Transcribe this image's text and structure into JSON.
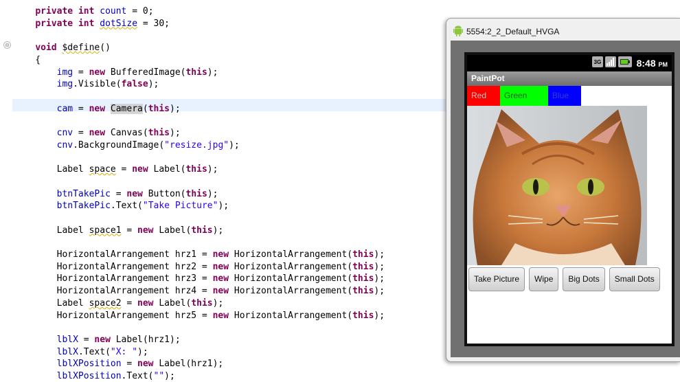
{
  "editor": {
    "fold_marker": "⊖",
    "lines": [
      [
        {
          "t": "    "
        },
        {
          "t": "private",
          "c": "kw"
        },
        {
          "t": " "
        },
        {
          "t": "int",
          "c": "kw"
        },
        {
          "t": " "
        },
        {
          "t": "count",
          "c": "fld"
        },
        {
          "t": " = 0;"
        }
      ],
      [
        {
          "t": "    "
        },
        {
          "t": "private",
          "c": "kw"
        },
        {
          "t": " "
        },
        {
          "t": "int",
          "c": "kw"
        },
        {
          "t": " "
        },
        {
          "t": "dotSize",
          "c": "fld sq"
        },
        {
          "t": " = 30;"
        }
      ],
      [],
      [
        {
          "t": "    "
        },
        {
          "t": "void",
          "c": "kw"
        },
        {
          "t": " "
        },
        {
          "t": "$define",
          "c": "sq"
        },
        {
          "t": "()"
        }
      ],
      [
        {
          "t": "    {"
        }
      ],
      [
        {
          "t": "        "
        },
        {
          "t": "img",
          "c": "fld"
        },
        {
          "t": " = "
        },
        {
          "t": "new",
          "c": "kw"
        },
        {
          "t": " BufferedImage("
        },
        {
          "t": "this",
          "c": "kw"
        },
        {
          "t": ");"
        }
      ],
      [
        {
          "t": "        "
        },
        {
          "t": "img",
          "c": "fld"
        },
        {
          "t": ".Visible("
        },
        {
          "t": "false",
          "c": "kw"
        },
        {
          "t": ");"
        }
      ],
      [],
      [
        {
          "t": "        "
        },
        {
          "t": "cam",
          "c": "fld"
        },
        {
          "t": " = "
        },
        {
          "t": "new",
          "c": "kw"
        },
        {
          "t": " "
        },
        {
          "t": "Camera",
          "c": "hl"
        },
        {
          "t": "("
        },
        {
          "t": "this",
          "c": "kw"
        },
        {
          "t": ");"
        }
      ],
      [],
      [
        {
          "t": "        "
        },
        {
          "t": "cnv",
          "c": "fld"
        },
        {
          "t": " = "
        },
        {
          "t": "new",
          "c": "kw"
        },
        {
          "t": " Canvas("
        },
        {
          "t": "this",
          "c": "kw"
        },
        {
          "t": ");"
        }
      ],
      [
        {
          "t": "        "
        },
        {
          "t": "cnv",
          "c": "fld"
        },
        {
          "t": ".BackgroundImage("
        },
        {
          "t": "\"resize.jpg\"",
          "c": "str"
        },
        {
          "t": ");"
        }
      ],
      [],
      [
        {
          "t": "        Label "
        },
        {
          "t": "space",
          "c": "sq"
        },
        {
          "t": " = "
        },
        {
          "t": "new",
          "c": "kw"
        },
        {
          "t": " Label("
        },
        {
          "t": "this",
          "c": "kw"
        },
        {
          "t": ");"
        }
      ],
      [],
      [
        {
          "t": "        "
        },
        {
          "t": "btnTakePic",
          "c": "fld"
        },
        {
          "t": " = "
        },
        {
          "t": "new",
          "c": "kw"
        },
        {
          "t": " Button("
        },
        {
          "t": "this",
          "c": "kw"
        },
        {
          "t": ");"
        }
      ],
      [
        {
          "t": "        "
        },
        {
          "t": "btnTakePic",
          "c": "fld"
        },
        {
          "t": ".Text("
        },
        {
          "t": "\"Take Picture\"",
          "c": "str"
        },
        {
          "t": ");"
        }
      ],
      [],
      [
        {
          "t": "        Label "
        },
        {
          "t": "space1",
          "c": "sq"
        },
        {
          "t": " = "
        },
        {
          "t": "new",
          "c": "kw"
        },
        {
          "t": " Label("
        },
        {
          "t": "this",
          "c": "kw"
        },
        {
          "t": ");"
        }
      ],
      [],
      [
        {
          "t": "        HorizontalArrangement hrz1 = "
        },
        {
          "t": "new",
          "c": "kw"
        },
        {
          "t": " HorizontalArrangement("
        },
        {
          "t": "this",
          "c": "kw"
        },
        {
          "t": ");"
        }
      ],
      [
        {
          "t": "        HorizontalArrangement hrz2 = "
        },
        {
          "t": "new",
          "c": "kw"
        },
        {
          "t": " HorizontalArrangement("
        },
        {
          "t": "this",
          "c": "kw"
        },
        {
          "t": ");"
        }
      ],
      [
        {
          "t": "        HorizontalArrangement hrz3 = "
        },
        {
          "t": "new",
          "c": "kw"
        },
        {
          "t": " HorizontalArrangement("
        },
        {
          "t": "this",
          "c": "kw"
        },
        {
          "t": ");"
        }
      ],
      [
        {
          "t": "        HorizontalArrangement hrz4 = "
        },
        {
          "t": "new",
          "c": "kw"
        },
        {
          "t": " HorizontalArrangement("
        },
        {
          "t": "this",
          "c": "kw"
        },
        {
          "t": ");"
        }
      ],
      [
        {
          "t": "        Label "
        },
        {
          "t": "space2",
          "c": "sq"
        },
        {
          "t": " = "
        },
        {
          "t": "new",
          "c": "kw"
        },
        {
          "t": " Label("
        },
        {
          "t": "this",
          "c": "kw"
        },
        {
          "t": ");"
        }
      ],
      [
        {
          "t": "        HorizontalArrangement hrz5 = "
        },
        {
          "t": "new",
          "c": "kw"
        },
        {
          "t": " HorizontalArrangement("
        },
        {
          "t": "this",
          "c": "kw"
        },
        {
          "t": ");"
        }
      ],
      [],
      [
        {
          "t": "        "
        },
        {
          "t": "lblX",
          "c": "fld"
        },
        {
          "t": " = "
        },
        {
          "t": "new",
          "c": "kw"
        },
        {
          "t": " Label(hrz1);"
        }
      ],
      [
        {
          "t": "        "
        },
        {
          "t": "lblX",
          "c": "fld"
        },
        {
          "t": ".Text("
        },
        {
          "t": "\"X: \"",
          "c": "str"
        },
        {
          "t": ");"
        }
      ],
      [
        {
          "t": "        "
        },
        {
          "t": "lblXPosition",
          "c": "fld"
        },
        {
          "t": " = "
        },
        {
          "t": "new",
          "c": "kw"
        },
        {
          "t": " Label(hrz1);"
        }
      ],
      [
        {
          "t": "        "
        },
        {
          "t": "lblXPosition",
          "c": "fld"
        },
        {
          "t": ".Text("
        },
        {
          "t": "\"\"",
          "c": "str"
        },
        {
          "t": ");"
        }
      ]
    ]
  },
  "emulator": {
    "window_title": "5554:2_2_Default_HVGA",
    "status_bar": {
      "network_label": "3G",
      "time": "8:48",
      "ampm": "PM",
      "icons": [
        "network-3g-icon",
        "signal-icon",
        "battery-icon"
      ]
    },
    "app_title": "PaintPot",
    "color_buttons": [
      {
        "label": "Red",
        "color": "#ff0000"
      },
      {
        "label": "Green",
        "color": "#00ff00"
      },
      {
        "label": "Blue",
        "color": "#0000ff"
      }
    ],
    "canvas_image": "cat-photo",
    "action_buttons": [
      {
        "label": "Take Picture"
      },
      {
        "label": "Wipe"
      },
      {
        "label": "Big Dots"
      },
      {
        "label": "Small Dots"
      }
    ]
  }
}
